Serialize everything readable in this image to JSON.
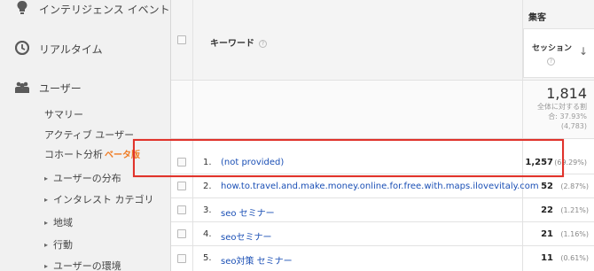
{
  "sidebar": {
    "items": [
      {
        "label": "インテリジェンス イベント",
        "icon": "lightbulb-icon"
      },
      {
        "label": "リアルタイム",
        "icon": "clock-icon"
      },
      {
        "label": "ユーザー",
        "icon": "users-icon"
      }
    ],
    "sub_items": [
      {
        "label": "サマリー"
      },
      {
        "label": "アクティブ ユーザー"
      },
      {
        "label": "コホート分析",
        "badge": "ベータ版"
      },
      {
        "label": "ユーザーの分布"
      },
      {
        "label": "インタレスト カテゴリ"
      },
      {
        "label": "地域"
      },
      {
        "label": "行動"
      },
      {
        "label": "ユーザーの環境"
      }
    ]
  },
  "table": {
    "keyword_header": "キーワード",
    "group_header": "集客",
    "sessions_header": "セッション",
    "summary": {
      "total": "1,814",
      "note_line1": "全体に対する割",
      "note_line2": "合: 37.93%",
      "note_line3": "(4,783)"
    },
    "rows": [
      {
        "num": "1.",
        "keyword": "(not provided)",
        "sessions": "1,257",
        "pct": "(69.29%)"
      },
      {
        "num": "2.",
        "keyword": "how.to.travel.and.make.money.online.for.free.with.maps.ilovevitaly.com",
        "sessions": "52",
        "pct": "(2.87%)"
      },
      {
        "num": "3.",
        "keyword": "seo セミナー",
        "sessions": "22",
        "pct": "(1.21%)"
      },
      {
        "num": "4.",
        "keyword": "seoセミナー",
        "sessions": "21",
        "pct": "(1.16%)"
      },
      {
        "num": "5.",
        "keyword": "seo対策 セミナー",
        "sessions": "11",
        "pct": "(0.61%)"
      }
    ]
  },
  "colors": {
    "link": "#1a4fb5",
    "highlight": "#e0332b",
    "beta": "#f07b22"
  }
}
